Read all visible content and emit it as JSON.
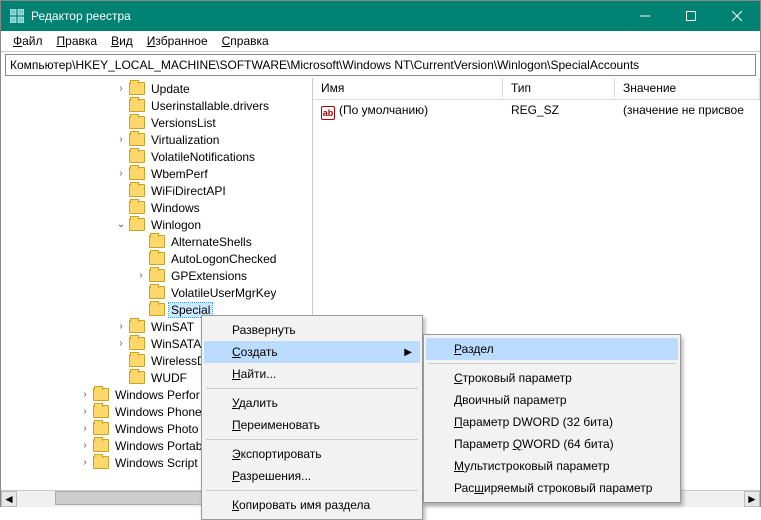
{
  "titlebar": {
    "title": "Редактор реестра"
  },
  "menubar": {
    "file_pre": "Ф",
    "file_rest": "айл",
    "edit_pre": "П",
    "edit_rest": "равка",
    "view_pre": "В",
    "view_rest": "ид",
    "fav_pre": "И",
    "fav_rest": "збранное",
    "help_pre": "С",
    "help_rest": "правка"
  },
  "address": "Компьютер\\HKEY_LOCAL_MACHINE\\SOFTWARE\\Microsoft\\Windows NT\\CurrentVersion\\Winlogon\\SpecialAccounts",
  "list": {
    "cols": {
      "name": "Имя",
      "type": "Тип",
      "value": "Значение"
    },
    "rows": [
      {
        "name": "(По умолчанию)",
        "type": "REG_SZ",
        "value": "(значение не присвое"
      }
    ]
  },
  "tree": {
    "items": [
      {
        "indent": 112,
        "twisty": ">",
        "label": "Update"
      },
      {
        "indent": 112,
        "twisty": "",
        "label": "Userinstallable.drivers"
      },
      {
        "indent": 112,
        "twisty": "",
        "label": "VersionsList"
      },
      {
        "indent": 112,
        "twisty": ">",
        "label": "Virtualization"
      },
      {
        "indent": 112,
        "twisty": "",
        "label": "VolatileNotifications"
      },
      {
        "indent": 112,
        "twisty": ">",
        "label": "WbemPerf"
      },
      {
        "indent": 112,
        "twisty": "",
        "label": "WiFiDirectAPI"
      },
      {
        "indent": 112,
        "twisty": "",
        "label": "Windows"
      },
      {
        "indent": 112,
        "twisty": "v",
        "label": "Winlogon"
      },
      {
        "indent": 132,
        "twisty": "",
        "label": "AlternateShells"
      },
      {
        "indent": 132,
        "twisty": "",
        "label": "AutoLogonChecked"
      },
      {
        "indent": 132,
        "twisty": ">",
        "label": "GPExtensions"
      },
      {
        "indent": 132,
        "twisty": "",
        "label": "VolatileUserMgrKey"
      },
      {
        "indent": 132,
        "twisty": "",
        "label": "Special",
        "selected": true
      },
      {
        "indent": 112,
        "twisty": ">",
        "label": "WinSAT"
      },
      {
        "indent": 112,
        "twisty": ">",
        "label": "WinSATAP"
      },
      {
        "indent": 112,
        "twisty": "",
        "label": "WirelessDo"
      },
      {
        "indent": 112,
        "twisty": "",
        "label": "WUDF"
      },
      {
        "indent": 76,
        "twisty": ">",
        "label": "Windows Perfor"
      },
      {
        "indent": 76,
        "twisty": ">",
        "label": "Windows Phone"
      },
      {
        "indent": 76,
        "twisty": ">",
        "label": "Windows Photo"
      },
      {
        "indent": 76,
        "twisty": ">",
        "label": "Windows Portab"
      },
      {
        "indent": 76,
        "twisty": ">",
        "label": "Windows Script"
      }
    ]
  },
  "ctx1": {
    "expand": "Развернуть",
    "create_u": "С",
    "create_r": "оздать",
    "find_u": "Н",
    "find_r": "айти...",
    "delete_u": "У",
    "delete_r": "далить",
    "rename_u": "П",
    "rename_r": "ереименовать",
    "export_u": "Э",
    "export_r": "кспортировать",
    "perm_u": "Р",
    "perm_r": "азрешения...",
    "copy_u": "К",
    "copy_r": "опировать имя раздела"
  },
  "ctx2": {
    "key_u": "Р",
    "key_r": "аздел",
    "str_u": "С",
    "str_r": "троковый параметр",
    "bin_u": "Д",
    "bin_r": "воичный параметр",
    "dword_u": "П",
    "dword_r": "араметр DWORD (32 бита)",
    "qword_pre": "Параметр ",
    "qword_u": "Q",
    "qword_r": "WORD (64 бита)",
    "multi_u": "М",
    "multi_r": "ультистроковый параметр",
    "exp_pre": "Рас",
    "exp_u": "ш",
    "exp_r": "иряемый строковый параметр"
  }
}
